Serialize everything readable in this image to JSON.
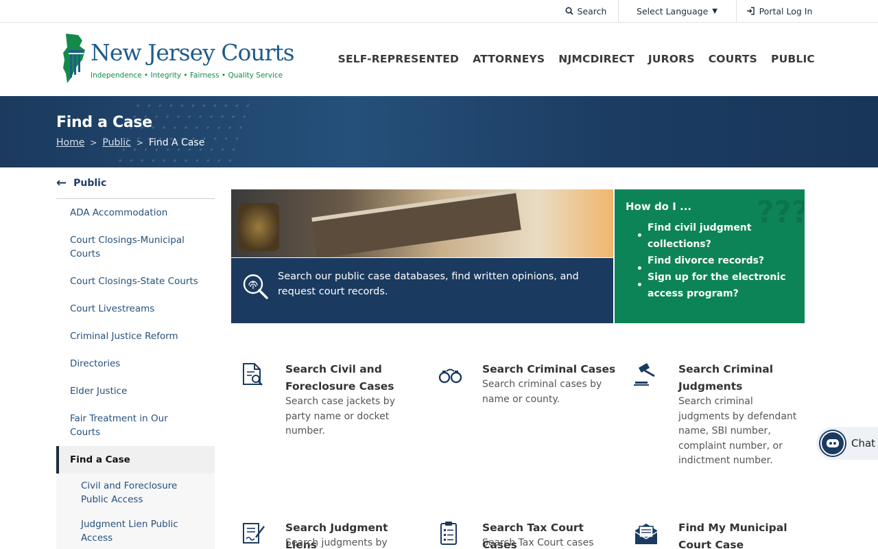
{
  "utility": {
    "search_label": "Search",
    "language_label": "Select Language",
    "portal_label": "Portal Log In"
  },
  "header": {
    "logo_title": "New Jersey Courts",
    "logo_tagline": "Independence • Integrity • Fairness • Quality Service",
    "nav": [
      "SELF-REPRESENTED",
      "ATTORNEYS",
      "NJMCDIRECT",
      "JURORS",
      "COURTS",
      "PUBLIC"
    ]
  },
  "banner": {
    "title": "Find a Case",
    "breadcrumb": [
      "Home",
      "Public",
      "Find A Case"
    ]
  },
  "sidebar": {
    "back_label": "Public",
    "items": [
      "ADA Accommodation",
      "Court Closings-Municipal Courts",
      "Court Closings-State Courts",
      "Court Livestreams",
      "Criminal Justice Reform",
      "Directories",
      "Elder Justice",
      "Fair Treatment in Our Courts",
      "Find a Case"
    ],
    "sub_items": [
      "Civil and Foreclosure Public Access",
      "Judgment Lien Public Access"
    ]
  },
  "hero": {
    "text": "Search our public case databases, find written opinions, and request court records.",
    "howdo_title": "How do I ...",
    "howdo_items": [
      "Find civil judgment collections?",
      "Find divorce records?",
      "Sign up for the electronic access program?"
    ]
  },
  "cards": [
    {
      "title": "Search Civil and Foreclosure Cases",
      "desc": "Search case jackets by party name or docket number.",
      "icon": "document-search-icon"
    },
    {
      "title": "Search Criminal Cases",
      "desc": "Search criminal cases by name or county.",
      "icon": "handcuffs-icon"
    },
    {
      "title": "Search Criminal Judgments",
      "desc": "Search criminal judgments by defendant name, SBI number, complaint number, or indictment number.",
      "icon": "gavel-icon"
    },
    {
      "title": "Search Judgment Liens",
      "desc": "Search judgments by",
      "icon": "signed-document-icon"
    },
    {
      "title": "Search Tax Court Cases",
      "desc": "Search Tax Court cases",
      "icon": "clipboard-checklist-icon"
    },
    {
      "title": "Find My Municipal Court Case",
      "desc": "",
      "icon": "envelope-letter-icon"
    }
  ],
  "chat": {
    "label": "Chat"
  },
  "colors": {
    "primary_navy": "#1b3a60",
    "green": "#0d8457",
    "link_blue": "#24507d"
  }
}
